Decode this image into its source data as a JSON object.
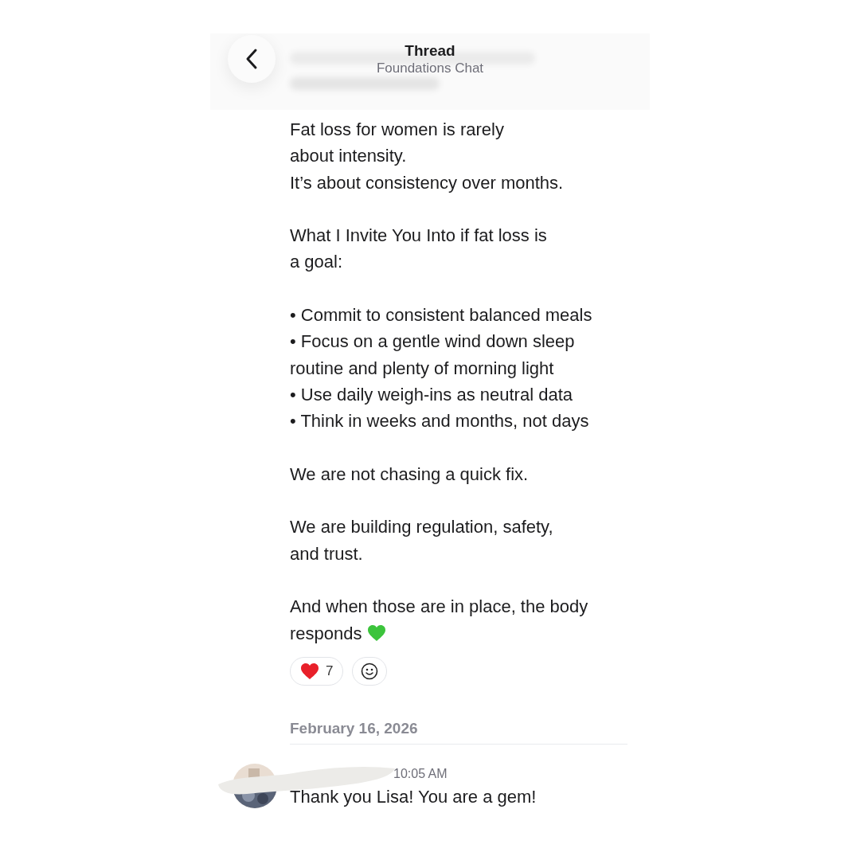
{
  "header": {
    "title": "Thread",
    "subtitle": "Foundations Chat"
  },
  "message": {
    "blocks": [
      {
        "kind": "paragraph",
        "lines": [
          "Fat loss for women is rarely",
          "about intensity.",
          "It’s about consistency over months."
        ]
      },
      {
        "kind": "paragraph",
        "lines": [
          "What I Invite You Into if fat loss is",
          "a goal:"
        ]
      },
      {
        "kind": "list",
        "items": [
          {
            "lines": [
              "• Commit to consistent balanced meals"
            ]
          },
          {
            "lines": [
              "• Focus on a gentle wind down sleep",
              "routine and plenty of morning light"
            ]
          },
          {
            "lines": [
              "• Use daily weigh-ins as neutral data"
            ]
          },
          {
            "lines": [
              "• Think in weeks and months, not days"
            ]
          }
        ]
      },
      {
        "kind": "paragraph",
        "lines": [
          "We are not chasing a quick fix."
        ]
      },
      {
        "kind": "paragraph",
        "lines": [
          "We are building regulation, safety,",
          "and trust."
        ]
      },
      {
        "kind": "paragraph",
        "lines": [
          "And when those are in place, the body",
          "responds"
        ],
        "trailing_icon": true
      }
    ],
    "reactions": [
      {
        "kind": "emoji",
        "count": "7"
      },
      {
        "kind": "add"
      }
    ]
  },
  "date_divider": "February 16, 2026",
  "next_message": {
    "time": "10:05 AM",
    "text": "Thank you Lisa! You are a gem!"
  }
}
